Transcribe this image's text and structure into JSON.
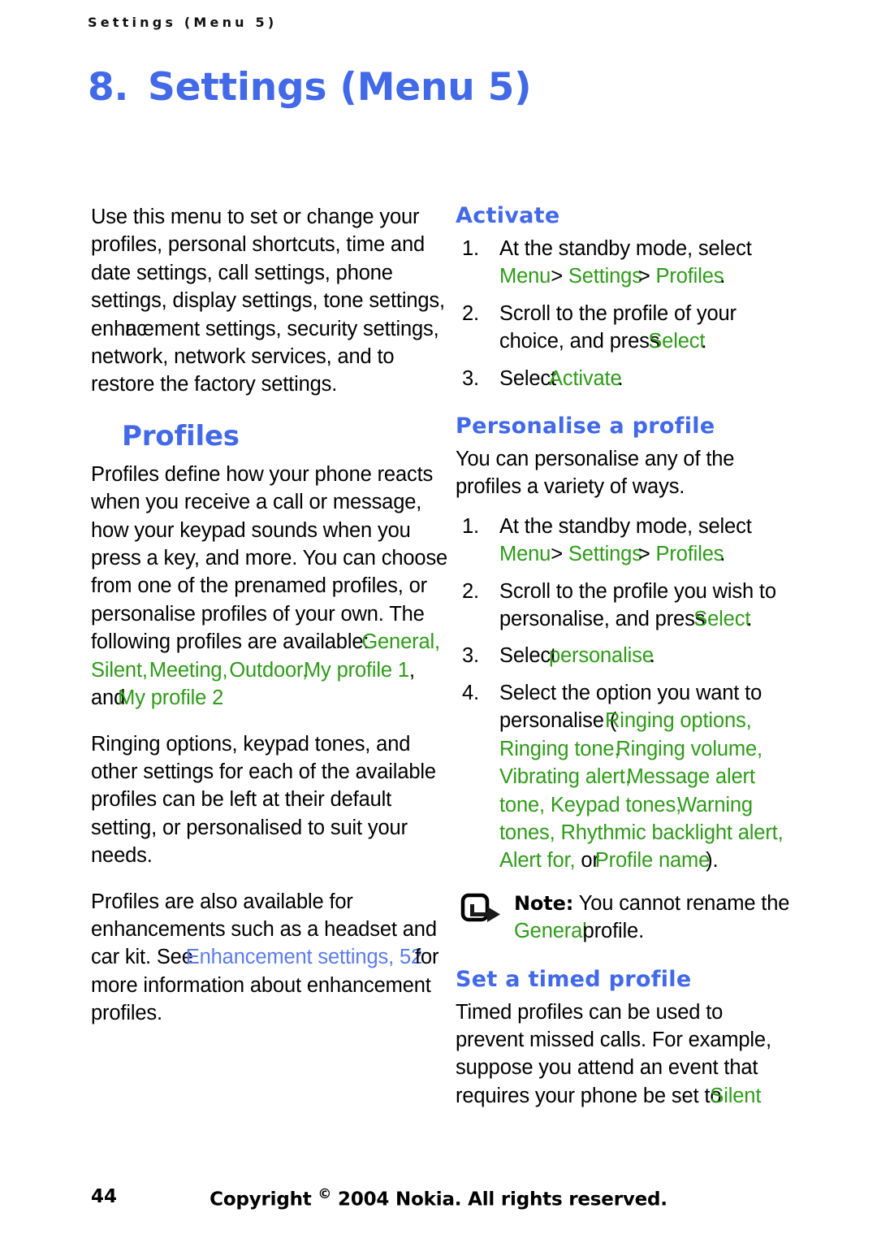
{
  "header": {
    "running_header": "Settings (Menu 5)"
  },
  "title": {
    "number": "8.",
    "text": "Settings (Menu 5)"
  },
  "colors": {
    "heading_blue": "#4169E8",
    "ui_green": "#2E9B18",
    "xref_blue": "#5A7CF0",
    "body_black": "#000000"
  },
  "left_column": {
    "intro": {
      "p1_a": "Use this menu to set or change your",
      "p1_b": "profiles, personal shortcuts, time and date settings, call settings, phone settings, display settings, tone settings, enha",
      "p1_overlap": "nc",
      "p1_c": "ement settings, security settings, network, network services, and to restore the factory settings."
    },
    "profiles_heading": "Profiles",
    "profiles_p1_a": "Profiles define how your phone reacts when you receive a call or message, how your keypad sounds when you press a key, and more. You can choose from one of the prenamed profiles, or personalise profiles of your own. The following profiles are available:",
    "profile_names": {
      "general": "General",
      "sep1": ",",
      "silent": "Silent",
      "sep2": ",",
      "meeting": "Meeting",
      "sep3": ",",
      "outdoor": "Outdoor",
      "sep4": ",",
      "my_profile_1": "My profile 1",
      "and": ", and",
      "my_profile_2": "My profile 2"
    },
    "profiles_p2": "Ringing options, keypad tones, and other settings for each of the available profiles can be left at their default setting, or personalised to suit your needs.",
    "profiles_p3_a": "Profiles are also available for enhancements such as a headset and car kit. See",
    "profiles_p3_xref_1": "Enhancement",
    "profiles_p3_xref_2": "settings, 52",
    "profiles_p3_b": "for more information about enhancement profiles."
  },
  "right_column": {
    "activate": {
      "heading": "Activate",
      "steps": [
        {
          "marker": "1.",
          "text_a": "At the standby mode, select",
          "ui_1": "Menu",
          "arrow_1": ">",
          "ui_2": "Settings",
          "arrow_2": ">",
          "ui_3": "Profiles",
          "text_b": "."
        },
        {
          "marker": "2.",
          "text_a": "Scroll to the profile of your choice, and press",
          "ui_1": "Select",
          "text_b": "."
        },
        {
          "marker": "3.",
          "text_a": "Select",
          "ui_1": "Activate",
          "text_b": "."
        }
      ]
    },
    "personalise": {
      "heading": "Personalise a profile",
      "intro": "You can personalise any of the profiles a variety of ways.",
      "steps": [
        {
          "marker": "1.",
          "text_a": "At the standby mode, select",
          "ui_1": "Menu",
          "arrow_1": ">",
          "ui_2": "Settings",
          "arrow_2": ">",
          "ui_3": "Profiles",
          "text_b": "."
        },
        {
          "marker": "2.",
          "text_a": "Scroll to the profile you wish to personalise, and press",
          "ui_1": "Select",
          "text_b": "."
        },
        {
          "marker": "3.",
          "text_a": "Select",
          "ui_1": "personalise",
          "text_b": "."
        },
        {
          "marker": "4.",
          "text_a": "Select the option you want to personalise (",
          "options": [
            "Ringing options",
            "Ringing tone",
            "Ringing volume",
            "Vibrating alert",
            "Message alert tone",
            "Keypad tones",
            "Warning tones",
            "Rhythmic backlight alert",
            "Alert for",
            "Profile name"
          ],
          "or_word": "or",
          "text_b": ")."
        }
      ]
    },
    "note": {
      "icon": "note-pointer-icon",
      "label": "Note:",
      "text_a": "You cannot rename the",
      "ui_1": "General",
      "text_b": "profile."
    },
    "timed": {
      "heading": "Set a timed profile",
      "text_a": "Timed profiles can be used to prevent missed calls. For example, suppose you attend an event that requires your phone be set to",
      "ui_1": "Silent"
    }
  },
  "footer": {
    "page_number": "44",
    "copyright_pre": "Copyright ",
    "copyright_symbol": "©",
    "copyright_post": " 2004 Nokia. All rights reserved."
  }
}
